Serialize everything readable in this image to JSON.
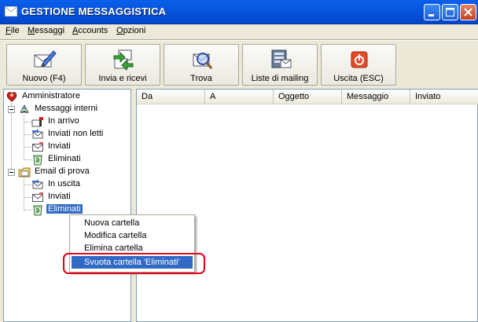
{
  "window": {
    "title": "GESTIONE MESSAGGISTICA",
    "controls": [
      "minimize-icon",
      "maximize-icon",
      "close-icon"
    ]
  },
  "menubar": {
    "items": [
      {
        "label": "File",
        "accel": "F",
        "rest": "ile"
      },
      {
        "label": "Messaggi",
        "accel": "M",
        "rest": "essaggi"
      },
      {
        "label": "Accounts",
        "accel": "A",
        "rest": "ccounts"
      },
      {
        "label": "Opzioni",
        "accel": "O",
        "rest": "pzioni"
      }
    ]
  },
  "toolbar": {
    "buttons": [
      {
        "label": "Nuovo (F4)",
        "icon": "compose-icon"
      },
      {
        "label": "Invia e ricevi",
        "icon": "send-receive-icon"
      },
      {
        "label": "Trova",
        "icon": "find-icon"
      },
      {
        "label": "Liste di mailing",
        "icon": "mailing-list-icon"
      },
      {
        "label": "Uscita (ESC)",
        "icon": "exit-icon"
      }
    ]
  },
  "tree": {
    "root": {
      "label": "Amministratore",
      "icon": "user-icon"
    },
    "groups": [
      {
        "label": "Messaggi interni",
        "icon": "internal-messages-icon",
        "children": [
          {
            "label": "In arrivo",
            "icon": "inbox-icon"
          },
          {
            "label": "Inviati non letti",
            "icon": "sent-unread-icon"
          },
          {
            "label": "Inviati",
            "icon": "sent-icon"
          },
          {
            "label": "Eliminati",
            "icon": "trash-icon"
          }
        ]
      },
      {
        "label": "Email di prova",
        "icon": "email-account-icon",
        "children": [
          {
            "label": "In uscita",
            "icon": "outbox-icon"
          },
          {
            "label": "Inviati",
            "icon": "sent-icon"
          },
          {
            "label": "Eliminati",
            "icon": "trash-icon",
            "selected": true
          }
        ]
      }
    ]
  },
  "message_list": {
    "columns": [
      "Da",
      "A",
      "Oggetto",
      "Messaggio",
      "Inviato"
    ],
    "rows": []
  },
  "context_menu": {
    "items": [
      {
        "label": "Nuova cartella"
      },
      {
        "label": "Modifica cartella"
      },
      {
        "label": "Elimina cartella"
      },
      {
        "label": "Svuota cartella 'Eliminati'",
        "highlighted": true
      }
    ]
  },
  "colors": {
    "titlebar": "#0A5FE8",
    "selection": "#316AC5",
    "annotation_ring": "#E0001B"
  }
}
